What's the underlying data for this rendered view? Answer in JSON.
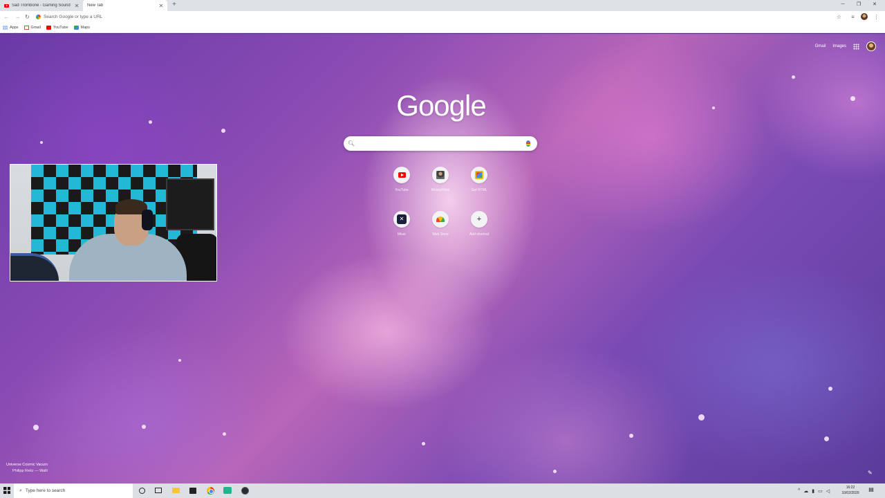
{
  "browser": {
    "tabs": [
      {
        "label": "Sad Trombone - Gaming Sound",
        "favicon": "youtube-icon",
        "active": false
      },
      {
        "label": "New Tab",
        "favicon": "",
        "active": true
      }
    ],
    "omnibox": {
      "placeholder": "Search Google or type a URL"
    },
    "bookmarks": [
      {
        "label": "Apps",
        "icon": "apps-icon"
      },
      {
        "label": "Gmail",
        "icon": "gmail-icon"
      },
      {
        "label": "YouTube",
        "icon": "youtube-icon"
      },
      {
        "label": "Maps",
        "icon": "maps-icon"
      }
    ]
  },
  "newtab": {
    "top_links": {
      "gmail": "Gmail",
      "images": "Images"
    },
    "logo": "Google",
    "search_value": "",
    "shortcuts": [
      {
        "label": "YouTube",
        "icon": "youtube-icon"
      },
      {
        "label": "MoistyFilms",
        "icon": "person-icon"
      },
      {
        "label": "Get HTML",
        "icon": "gif-icon"
      },
      {
        "label": "Mixer",
        "icon": "mixer-icon"
      },
      {
        "label": "Web Store",
        "icon": "web-store-icon"
      },
      {
        "label": "Add shortcut",
        "icon": "plus-icon"
      }
    ],
    "background_credit": {
      "title": "Universe Cosmic Vacum",
      "author": "Philipp Reitz — Walli"
    }
  },
  "taskbar": {
    "search_placeholder": "Type here to search",
    "time": "16:22",
    "date": "10/02/2020"
  },
  "colors": {
    "accent": "#4285f4",
    "tabstrip": "#dee1e6",
    "taskbar": "#dcdfe3"
  }
}
